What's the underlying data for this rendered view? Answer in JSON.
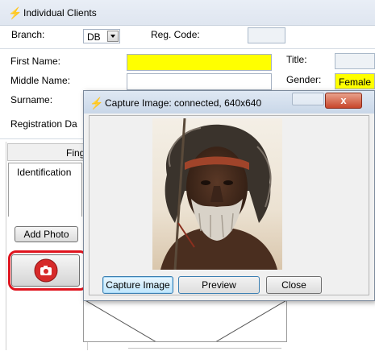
{
  "main_window": {
    "title": "Individual Clients",
    "app_icon": "lightning-icon"
  },
  "form": {
    "branch_label": "Branch:",
    "branch_value": "DB",
    "reg_code_label": "Reg. Code:",
    "first_name_label": "First Name:",
    "middle_name_label": "Middle Name:",
    "surname_label": "Surname:",
    "registration_date_label": "Registration Da",
    "title_label": "Title:",
    "gender_label": "Gender:",
    "gender_value": "Female"
  },
  "left_panel": {
    "header_label": "Fing",
    "tab_label": "Identification",
    "add_photo_label": "Add Photo",
    "camera_icon": "camera-icon"
  },
  "dialog": {
    "title": "Capture Image: connected, 640x640",
    "close_label": "x",
    "buttons": {
      "capture": "Capture Image",
      "preview": "Preview",
      "close": "Close"
    }
  },
  "colors": {
    "highlight_yellow": "#ffff00",
    "annotation_red": "#e0141e",
    "camera_red": "#d62a2a"
  }
}
